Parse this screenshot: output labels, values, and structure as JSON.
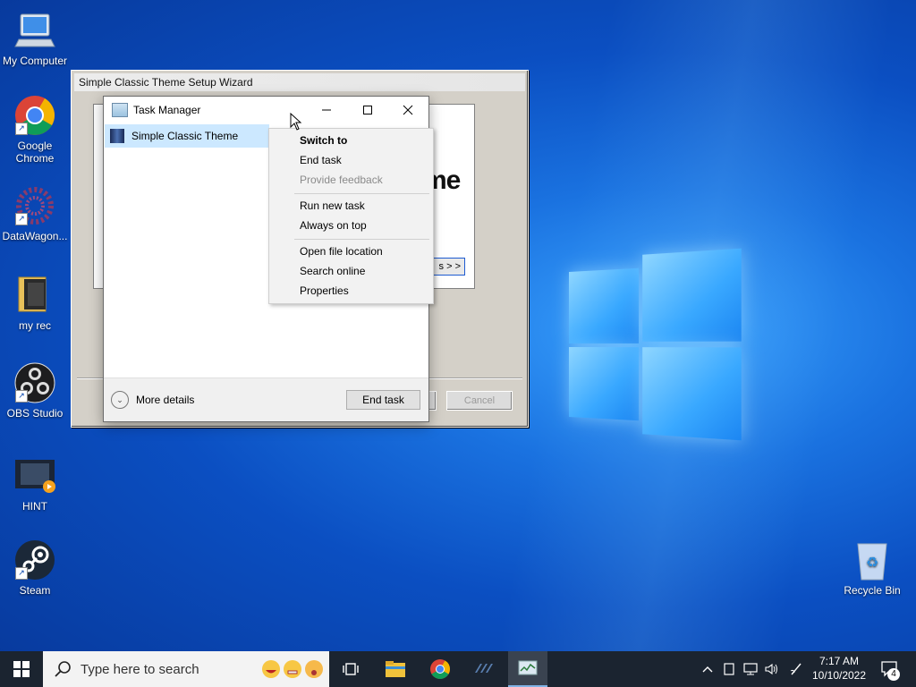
{
  "desktop": {
    "icons": [
      {
        "label": "My Computer"
      },
      {
        "label": "Google Chrome"
      },
      {
        "label": "DataWagon..."
      },
      {
        "label": "my rec"
      },
      {
        "label": "OBS Studio"
      },
      {
        "label": "HINT"
      },
      {
        "label": "Steam"
      },
      {
        "label": "Recycle Bin"
      }
    ]
  },
  "wizard": {
    "title": "Simple Classic Theme Setup Wizard",
    "partial_heading": "me",
    "next_button": "s > >",
    "cancel_button": "Cancel"
  },
  "task_manager": {
    "title": "Task Manager",
    "process": "Simple Classic Theme",
    "more_details": "More details",
    "end_task_button": "End task"
  },
  "context_menu": {
    "items": [
      {
        "label": "Switch to",
        "style": "bold"
      },
      {
        "label": "End task",
        "style": "normal"
      },
      {
        "label": "Provide feedback",
        "style": "disabled"
      },
      {
        "label": "Run new task",
        "style": "normal"
      },
      {
        "label": "Always on top",
        "style": "normal"
      },
      {
        "label": "Open file location",
        "style": "normal"
      },
      {
        "label": "Search online",
        "style": "normal"
      },
      {
        "label": "Properties",
        "style": "normal"
      }
    ]
  },
  "taskbar": {
    "search_placeholder": "Type here to search",
    "pinned": [
      "task-view-icon",
      "file-explorer-icon",
      "chrome-icon",
      "datawagon-icon",
      "task-manager-icon"
    ],
    "clock_time": "7:17 AM",
    "clock_date": "10/10/2022",
    "notification_count": "4"
  }
}
